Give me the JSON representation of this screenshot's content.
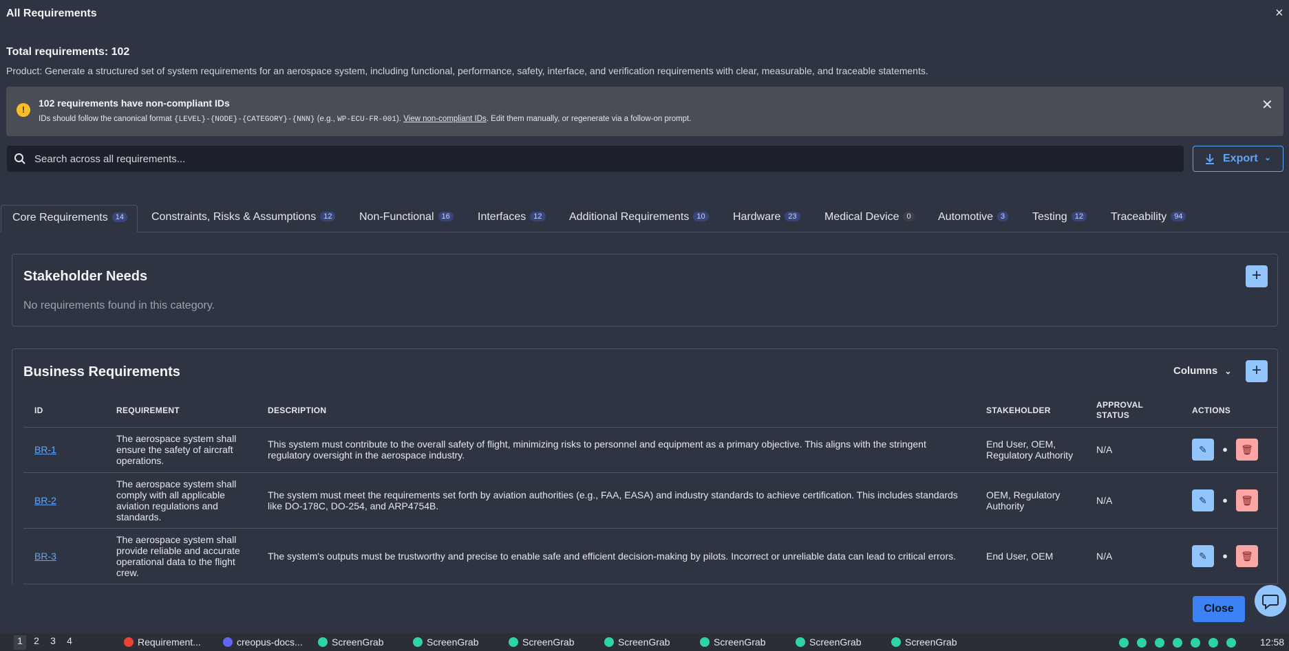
{
  "modal": {
    "title": "All Requirements",
    "close_icon": "×",
    "total": "Total requirements: 102",
    "product": "Product: Generate a structured set of system requirements for an aerospace system, including functional, performance, safety, interface, and verification requirements with clear, measurable, and traceable statements."
  },
  "warning": {
    "title": "102 requirements have non-compliant IDs",
    "text_prefix": "IDs should follow the canonical format ",
    "format": "{LEVEL}-{NODE}-{CATEGORY}-{NNN}",
    "text_mid": " (e.g., ",
    "example": "WP-ECU-FR-001",
    "text_after_example": "). ",
    "link": "View non-compliant IDs",
    "text_suffix": ". Edit them manually, or regenerate via a follow-on prompt.",
    "icon": "!",
    "close_icon": "✕",
    "accent_color": "#fbbf24"
  },
  "search": {
    "placeholder": "Search across all requirements..."
  },
  "export": {
    "label": "Export",
    "chevron": "⌄"
  },
  "tabs": [
    {
      "label": "Core Requirements",
      "count": "14"
    },
    {
      "label": "Constraints, Risks & Assumptions",
      "count": "12"
    },
    {
      "label": "Non-Functional",
      "count": "16"
    },
    {
      "label": "Interfaces",
      "count": "12"
    },
    {
      "label": "Additional Requirements",
      "count": "10"
    },
    {
      "label": "Hardware",
      "count": "23"
    },
    {
      "label": "Medical Device",
      "count": "0"
    },
    {
      "label": "Automotive",
      "count": "3"
    },
    {
      "label": "Testing",
      "count": "12"
    },
    {
      "label": "Traceability",
      "count": "94"
    }
  ],
  "stakeholder": {
    "title": "Stakeholder Needs",
    "empty": "No requirements found in this category.",
    "add": "+"
  },
  "business": {
    "title": "Business Requirements",
    "columns_label": "Columns",
    "columns_chevron": "⌄",
    "add": "+",
    "headers": [
      "ID",
      "REQUIREMENT",
      "DESCRIPTION",
      "STAKEHOLDER",
      "APPROVAL STATUS",
      "ACTIONS"
    ],
    "rows": [
      {
        "id": "BR-1",
        "requirement": "The aerospace system shall ensure the safety of aircraft operations.",
        "description": "This system must contribute to the overall safety of flight, minimizing risks to personnel and equipment as a primary objective. This aligns with the stringent regulatory oversight in the aerospace industry.",
        "stakeholder": "End User, OEM, Regulatory Authority",
        "status": "N/A"
      },
      {
        "id": "BR-2",
        "requirement": "The aerospace system shall comply with all applicable aviation regulations and standards.",
        "description": "The system must meet the requirements set forth by aviation authorities (e.g., FAA, EASA) and industry standards to achieve certification. This includes standards like DO-178C, DO-254, and ARP4754B.",
        "stakeholder": "OEM, Regulatory Authority",
        "status": "N/A"
      },
      {
        "id": "BR-3",
        "requirement": "The aerospace system shall provide reliable and accurate operational data to the flight crew.",
        "description": "The system's outputs must be trustworthy and precise to enable safe and efficient decision-making by pilots. Incorrect or unreliable data can lead to critical errors.",
        "stakeholder": "End User, OEM",
        "status": "N/A"
      }
    ]
  },
  "footer": {
    "close_label": "Close"
  },
  "taskbar": {
    "workspaces": [
      "1",
      "2",
      "3",
      "4"
    ],
    "apps": [
      "Requirement...",
      "creopus-docs...",
      "ScreenGrab",
      "ScreenGrab",
      "ScreenGrab",
      "ScreenGrab",
      "ScreenGrab",
      "ScreenGrab",
      "ScreenGrab"
    ],
    "clock": "12:58"
  }
}
